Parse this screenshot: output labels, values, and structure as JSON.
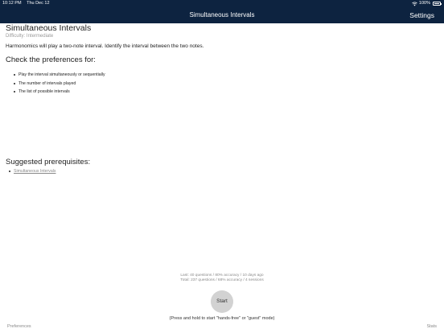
{
  "status_bar": {
    "time": "10:12 PM",
    "date": "Thu Dec 12",
    "battery": "100%"
  },
  "nav": {
    "title": "Simultaneous Intervals",
    "settings_label": "Settings",
    "background_color": "#0d2340"
  },
  "exercise": {
    "title": "Simultaneous Intervals",
    "difficulty": "Difficulty: Intermediate",
    "description": "Harmonomics will play a two-note interval. Identify the interval between the two notes."
  },
  "preferences_section": {
    "heading": "Check the preferences for:",
    "items": [
      "Play the interval simultaneously or sequentially",
      "The number of intervals played",
      "The list of possible intervals"
    ]
  },
  "prerequisites": {
    "heading": "Suggested prerequisites:",
    "items": [
      "Simultaneous Intervals"
    ]
  },
  "stats": {
    "last": "Last: 40 questions / 80% accuracy / 10 days ago",
    "total": "Total: 237 questions / 68% accuracy / 4 sessions"
  },
  "start": {
    "label": "Start",
    "hint": "(Press and hold to start \"hands-free\" or \"guest\" mode)"
  },
  "bottom_bar": {
    "left_label": "Preferences",
    "right_label": "Stats"
  }
}
